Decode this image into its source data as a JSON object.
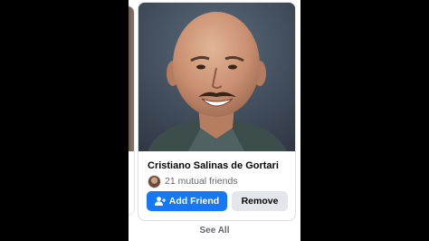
{
  "suggestion": {
    "name": "Cristiano Salinas de Gortari",
    "mutual_friends": "21 mutual friends",
    "add_friend_label": "Add Friend",
    "remove_label": "Remove"
  },
  "footer": {
    "see_all_label": "See All"
  },
  "icons": {
    "add_friend": "person-add-icon"
  },
  "colors": {
    "primary_button": "#1877f2",
    "secondary_button": "#e4e6eb",
    "text_primary": "#050505",
    "text_secondary": "#65676b"
  }
}
